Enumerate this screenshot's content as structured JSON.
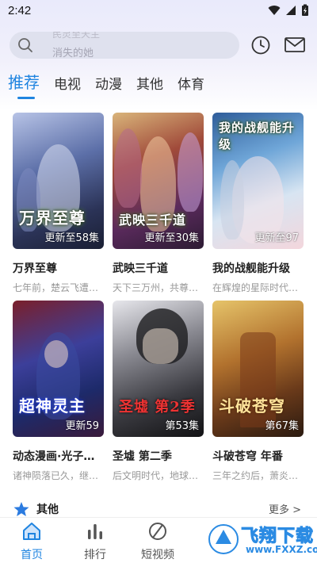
{
  "status_bar": {
    "time": "2:42"
  },
  "search": {
    "ghost_top": "民灵至天主",
    "ghost_main": "消失的她"
  },
  "tabs": [
    {
      "label": "推荐",
      "active": true
    },
    {
      "label": "电视"
    },
    {
      "label": "动漫"
    },
    {
      "label": "其他"
    },
    {
      "label": "体育"
    }
  ],
  "cards": [
    {
      "title": "万界至尊",
      "desc": "七年前，楚云飞遭…",
      "badge": "更新至58集",
      "cover_text": "万界至尊"
    },
    {
      "title": "武映三千道",
      "desc": "天下三万州，共尊…",
      "badge": "更新至30集",
      "cover_text": "武映三千道"
    },
    {
      "title": "我的战舰能升级",
      "desc": "在辉煌的星际时代…",
      "badge": "更新至97",
      "cover_text": "我的战舰能升级"
    },
    {
      "title": "动态漫画·光子…",
      "desc": "诸神陨落已久，继…",
      "badge": "更新59",
      "cover_text": "超神灵主"
    },
    {
      "title": "圣墟 第二季",
      "desc": "后文明时代，地球…",
      "badge": "第53集",
      "cover_text": "圣墟 第2季"
    },
    {
      "title": "斗破苍穹 年番",
      "desc": "三年之约后，萧炎…",
      "badge": "第67集",
      "cover_text": "斗破苍穹"
    }
  ],
  "section": {
    "title": "其他",
    "more": "更多 >"
  },
  "bottom_nav": [
    {
      "label": "首页",
      "icon": "home-icon",
      "active": true
    },
    {
      "label": "排行",
      "icon": "rank-icon"
    },
    {
      "label": "短视频",
      "icon": "short-video-icon"
    }
  ],
  "watermark": {
    "line1": "飞翔下载",
    "line2": "www.FXXZ.com"
  },
  "colors": {
    "accent": "#1f84e0",
    "search_bg": "#dcdeeb",
    "muted_text": "#999999"
  }
}
